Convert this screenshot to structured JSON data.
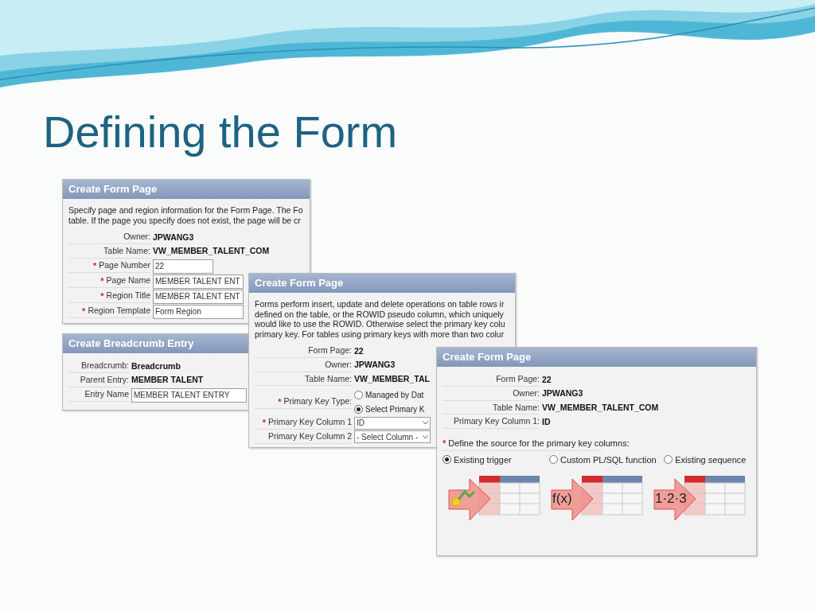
{
  "slide_title": "Defining the Form",
  "panels": [
    {
      "header": "Create Form Page",
      "intro": [
        "Specify page and region information for the Form Page. The Fo",
        "table. If the page you specify does not exist, the page will be cr"
      ],
      "rows": [
        {
          "kind": "static",
          "label": "Owner:",
          "value": "JPWANG3"
        },
        {
          "kind": "static",
          "label": "Table Name:",
          "value": "VW_MEMBER_TALENT_COM"
        },
        {
          "kind": "input",
          "required_mark": "*",
          "label": "Page Number",
          "value": "22"
        },
        {
          "kind": "input",
          "required_mark": "*",
          "label": "Page Name",
          "value": "MEMBER TALENT ENT"
        },
        {
          "kind": "input",
          "required_mark": "*",
          "label": "Region Title",
          "value": "MEMBER TALENT ENT"
        },
        {
          "kind": "input",
          "required_mark": "*",
          "label": "Region Template",
          "value": "Form Region"
        }
      ]
    },
    {
      "header": "Create Breadcrumb Entry",
      "rows": [
        {
          "kind": "static",
          "label": "Breadcrumb:",
          "value": "Breadcrumb"
        },
        {
          "kind": "static",
          "label": "Parent Entry:",
          "value": "MEMBER TALENT"
        },
        {
          "kind": "input",
          "label": "Entry Name",
          "value": "MEMBER TALENT ENTRY"
        }
      ]
    },
    {
      "header": "Create Form Page",
      "intro": [
        "Forms perform insert, update and delete operations on table rows ir",
        "defined on the table, or the ROWID pseudo column, which uniquely",
        "would like to use the ROWID. Otherwise select the primary key colu",
        "primary key. For tables using primary keys with more than two colur"
      ],
      "rows": [
        {
          "kind": "static",
          "label": "Form Page:",
          "value": "22"
        },
        {
          "kind": "static",
          "label": "Owner:",
          "value": "JPWANG3"
        },
        {
          "kind": "static",
          "label": "Table Name:",
          "value": "VW_MEMBER_TAL"
        },
        {
          "kind": "radio",
          "required_mark": "*",
          "label": "Primary Key Type:",
          "options": [
            {
              "label": "Managed by Dat",
              "selected": false
            },
            {
              "label": "Select Primary K",
              "selected": true
            }
          ]
        },
        {
          "kind": "select",
          "required_mark": "*",
          "label": "Primary Key Column 1",
          "value": "ID"
        },
        {
          "kind": "select",
          "label": "Primary Key Column 2",
          "value": "- Select Column -"
        }
      ]
    },
    {
      "header": "Create Form Page",
      "rows": [
        {
          "kind": "static",
          "label": "Form Page:",
          "value": "22"
        },
        {
          "kind": "static",
          "label": "Owner:",
          "value": "JPWANG3"
        },
        {
          "kind": "static",
          "label": "Table Name:",
          "value": "VW_MEMBER_TALENT_COM"
        },
        {
          "kind": "static",
          "label": "Primary Key Column 1:",
          "value": "ID"
        },
        {
          "kind": "prompt",
          "required_mark": "*",
          "label": "Define the source for the primary key columns:"
        },
        {
          "kind": "radio_row",
          "options": [
            {
              "label": "Existing trigger",
              "selected": true
            },
            {
              "label": "Custom PL/SQL function",
              "selected": false
            },
            {
              "label": "Existing sequence",
              "selected": false
            }
          ]
        }
      ],
      "sources": [
        {
          "kind": "trigger"
        },
        {
          "kind": "function",
          "label": "f(x)"
        },
        {
          "kind": "sequence",
          "label": "1·2·3"
        }
      ]
    }
  ]
}
